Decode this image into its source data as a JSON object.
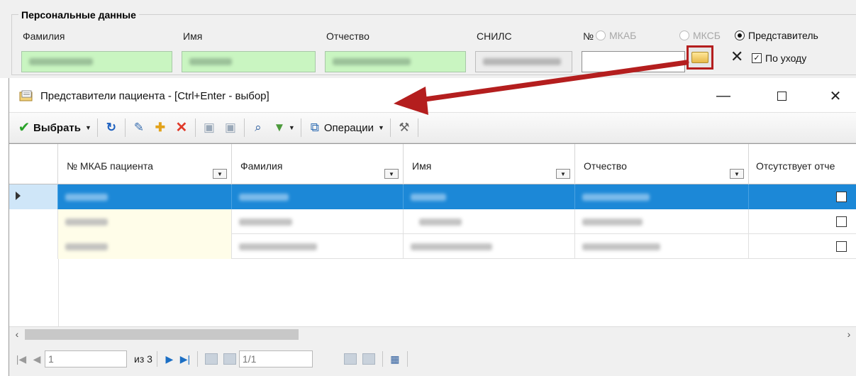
{
  "personal_data": {
    "title": "Персональные данные",
    "labels": {
      "surname": "Фамилия",
      "name": "Имя",
      "patronymic": "Отчество",
      "snils": "СНИЛС",
      "number": "№"
    },
    "radios": [
      {
        "label": "МКАБ",
        "checked": false
      },
      {
        "label": "МКСБ",
        "checked": false
      },
      {
        "label": "Представитель",
        "checked": true
      }
    ],
    "care_checkbox": {
      "label": "По уходу",
      "checked": true
    },
    "clear_glyph": "✕",
    "field_bg_color": "#c9f5c1"
  },
  "dialog": {
    "title": "Представители пациента - [Ctrl+Enter - выбор]",
    "window_controls": {
      "minimize": "—",
      "close": "✕"
    },
    "toolbar": {
      "select_label": "Выбрать",
      "operations_label": "Операции",
      "icons": [
        "check-icon",
        "refresh-icon",
        "edit-icon",
        "add-icon",
        "delete-icon",
        "save-icon",
        "save-all-icon",
        "find-icon",
        "filter-icon",
        "operations-icon",
        "tools-icon"
      ]
    },
    "grid": {
      "columns": [
        {
          "label": "№ МКАБ пациента",
          "dropdown": true
        },
        {
          "label": "Фамилия",
          "dropdown": true
        },
        {
          "label": "Имя",
          "dropdown": true
        },
        {
          "label": "Отчество",
          "dropdown": true
        },
        {
          "label": "Отсутствует отче",
          "dropdown": false
        }
      ],
      "rows": [
        {
          "selected": true,
          "checked": false
        },
        {
          "selected": false,
          "checked": false
        },
        {
          "selected": false,
          "checked": false
        }
      ],
      "selection_color": "#1c88d7"
    },
    "navigator": {
      "page_input": "1",
      "of_label": "из 3",
      "position_input": "1/1"
    }
  },
  "annotation_color": "#b41e1e"
}
